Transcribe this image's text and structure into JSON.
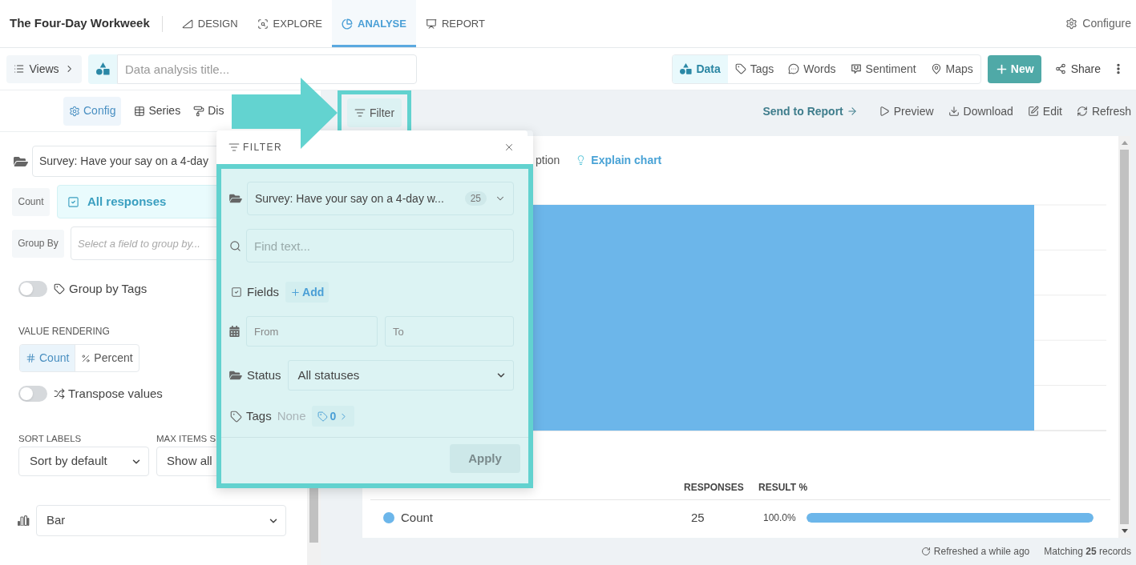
{
  "header": {
    "title": "The Four-Day Workweek",
    "tabs": [
      {
        "label": "DESIGN",
        "selected": false
      },
      {
        "label": "EXPLORE",
        "selected": false
      },
      {
        "label": "ANALYSE",
        "selected": true
      },
      {
        "label": "REPORT",
        "selected": false
      }
    ],
    "configure": "Configure"
  },
  "toolbar": {
    "views": "Views",
    "title_placeholder": "Data analysis title...",
    "modes": [
      {
        "label": "Data",
        "selected": true
      },
      {
        "label": "Tags",
        "selected": false
      },
      {
        "label": "Words",
        "selected": false
      },
      {
        "label": "Sentiment",
        "selected": false
      },
      {
        "label": "Maps",
        "selected": false
      }
    ],
    "new_button": "New",
    "share": "Share"
  },
  "left_panel": {
    "tabs": [
      {
        "label": "Config",
        "selected": true
      },
      {
        "label": "Series",
        "selected": false
      },
      {
        "label": "Dis",
        "selected": false
      }
    ],
    "source": "Survey: Have your say on a 4-day",
    "count": {
      "label": "Count",
      "value": "All responses"
    },
    "group_by": {
      "label": "Group By",
      "placeholder": "Select a field to group by..."
    },
    "group_by_tags": {
      "label": "Group by Tags",
      "on": false
    },
    "value_rendering": {
      "label": "VALUE RENDERING",
      "options": [
        {
          "label": "Count",
          "selected": true
        },
        {
          "label": "Percent",
          "selected": false
        }
      ]
    },
    "transpose": {
      "label": "Transpose values",
      "on": false
    },
    "sort_labels": {
      "label": "SORT LABELS",
      "value": "Sort by default"
    },
    "max_items": {
      "label": "MAX ITEMS S",
      "value": "Show all"
    },
    "chart_type": "Bar"
  },
  "content_toolbar": {
    "filter_button": "Filter",
    "send_to_report": "Send to Report",
    "actions": [
      "Preview",
      "Download",
      "Edit",
      "Refresh"
    ]
  },
  "chart_card": {
    "description_link": "ption",
    "explain_link": "Explain chart",
    "table": {
      "columns": [
        "RESPONSES",
        "RESULT %"
      ],
      "rows": [
        {
          "label": "Count",
          "color": "#6cb6ea",
          "responses": "25",
          "result": "100.0%",
          "level": 1
        }
      ]
    }
  },
  "status_bar": {
    "refreshed": "Refreshed a while ago",
    "matching": "Matching **25** records"
  },
  "filter_popup": {
    "title": "FILTER",
    "source": "Survey: Have your say on a 4-day w...",
    "source_count": "25",
    "search_placeholder": "Find text...",
    "fields_label": "Fields",
    "add_button": "Add",
    "from_placeholder": "From",
    "to_placeholder": "To",
    "status_label": "Status",
    "status_value": "All statuses",
    "tags_label": "Tags",
    "tags_value": "None",
    "tags_count": "0",
    "apply": "Apply"
  }
}
